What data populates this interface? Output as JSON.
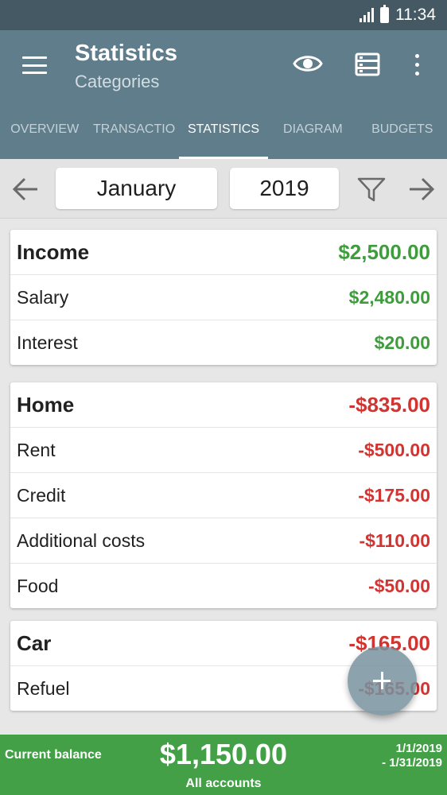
{
  "status": {
    "time": "11:34"
  },
  "appbar": {
    "title": "Statistics",
    "subtitle": "Categories"
  },
  "tabs": [
    {
      "label": "OVERVIEW"
    },
    {
      "label": "TRANSACTIO"
    },
    {
      "label": "STATISTICS",
      "active": true
    },
    {
      "label": "DIAGRAM"
    },
    {
      "label": "BUDGETS"
    }
  ],
  "period": {
    "month": "January",
    "year": "2019"
  },
  "categories": {
    "income": {
      "name": "Income",
      "total": "$2,500.00",
      "items": [
        {
          "name": "Salary",
          "amount": "$2,480.00"
        },
        {
          "name": "Interest",
          "amount": "$20.00"
        }
      ]
    },
    "home": {
      "name": "Home",
      "total": "-$835.00",
      "items": [
        {
          "name": "Rent",
          "amount": "-$500.00"
        },
        {
          "name": "Credit",
          "amount": "-$175.00"
        },
        {
          "name": "Additional costs",
          "amount": "-$110.00"
        },
        {
          "name": "Food",
          "amount": "-$50.00"
        }
      ]
    },
    "car": {
      "name": "Car",
      "total": "-$165.00",
      "items": [
        {
          "name": "Refuel",
          "amount": "-$165.00"
        }
      ]
    }
  },
  "footer": {
    "label": "Current balance",
    "balance": "$1,150.00",
    "accounts": "All accounts",
    "date_from": "1/1/2019",
    "date_to": "- 1/31/2019"
  },
  "colors": {
    "appbar": "#5f7d8b",
    "statusbar": "#445964",
    "positive": "#3f9c3d",
    "negative": "#d23431",
    "footer": "#43a047"
  },
  "icons": [
    "menu-icon",
    "eye-icon",
    "list-view-icon",
    "more-vert-icon",
    "arrow-left-icon",
    "arrow-right-icon",
    "filter-icon",
    "add-icon",
    "signal-icon",
    "battery-icon"
  ]
}
